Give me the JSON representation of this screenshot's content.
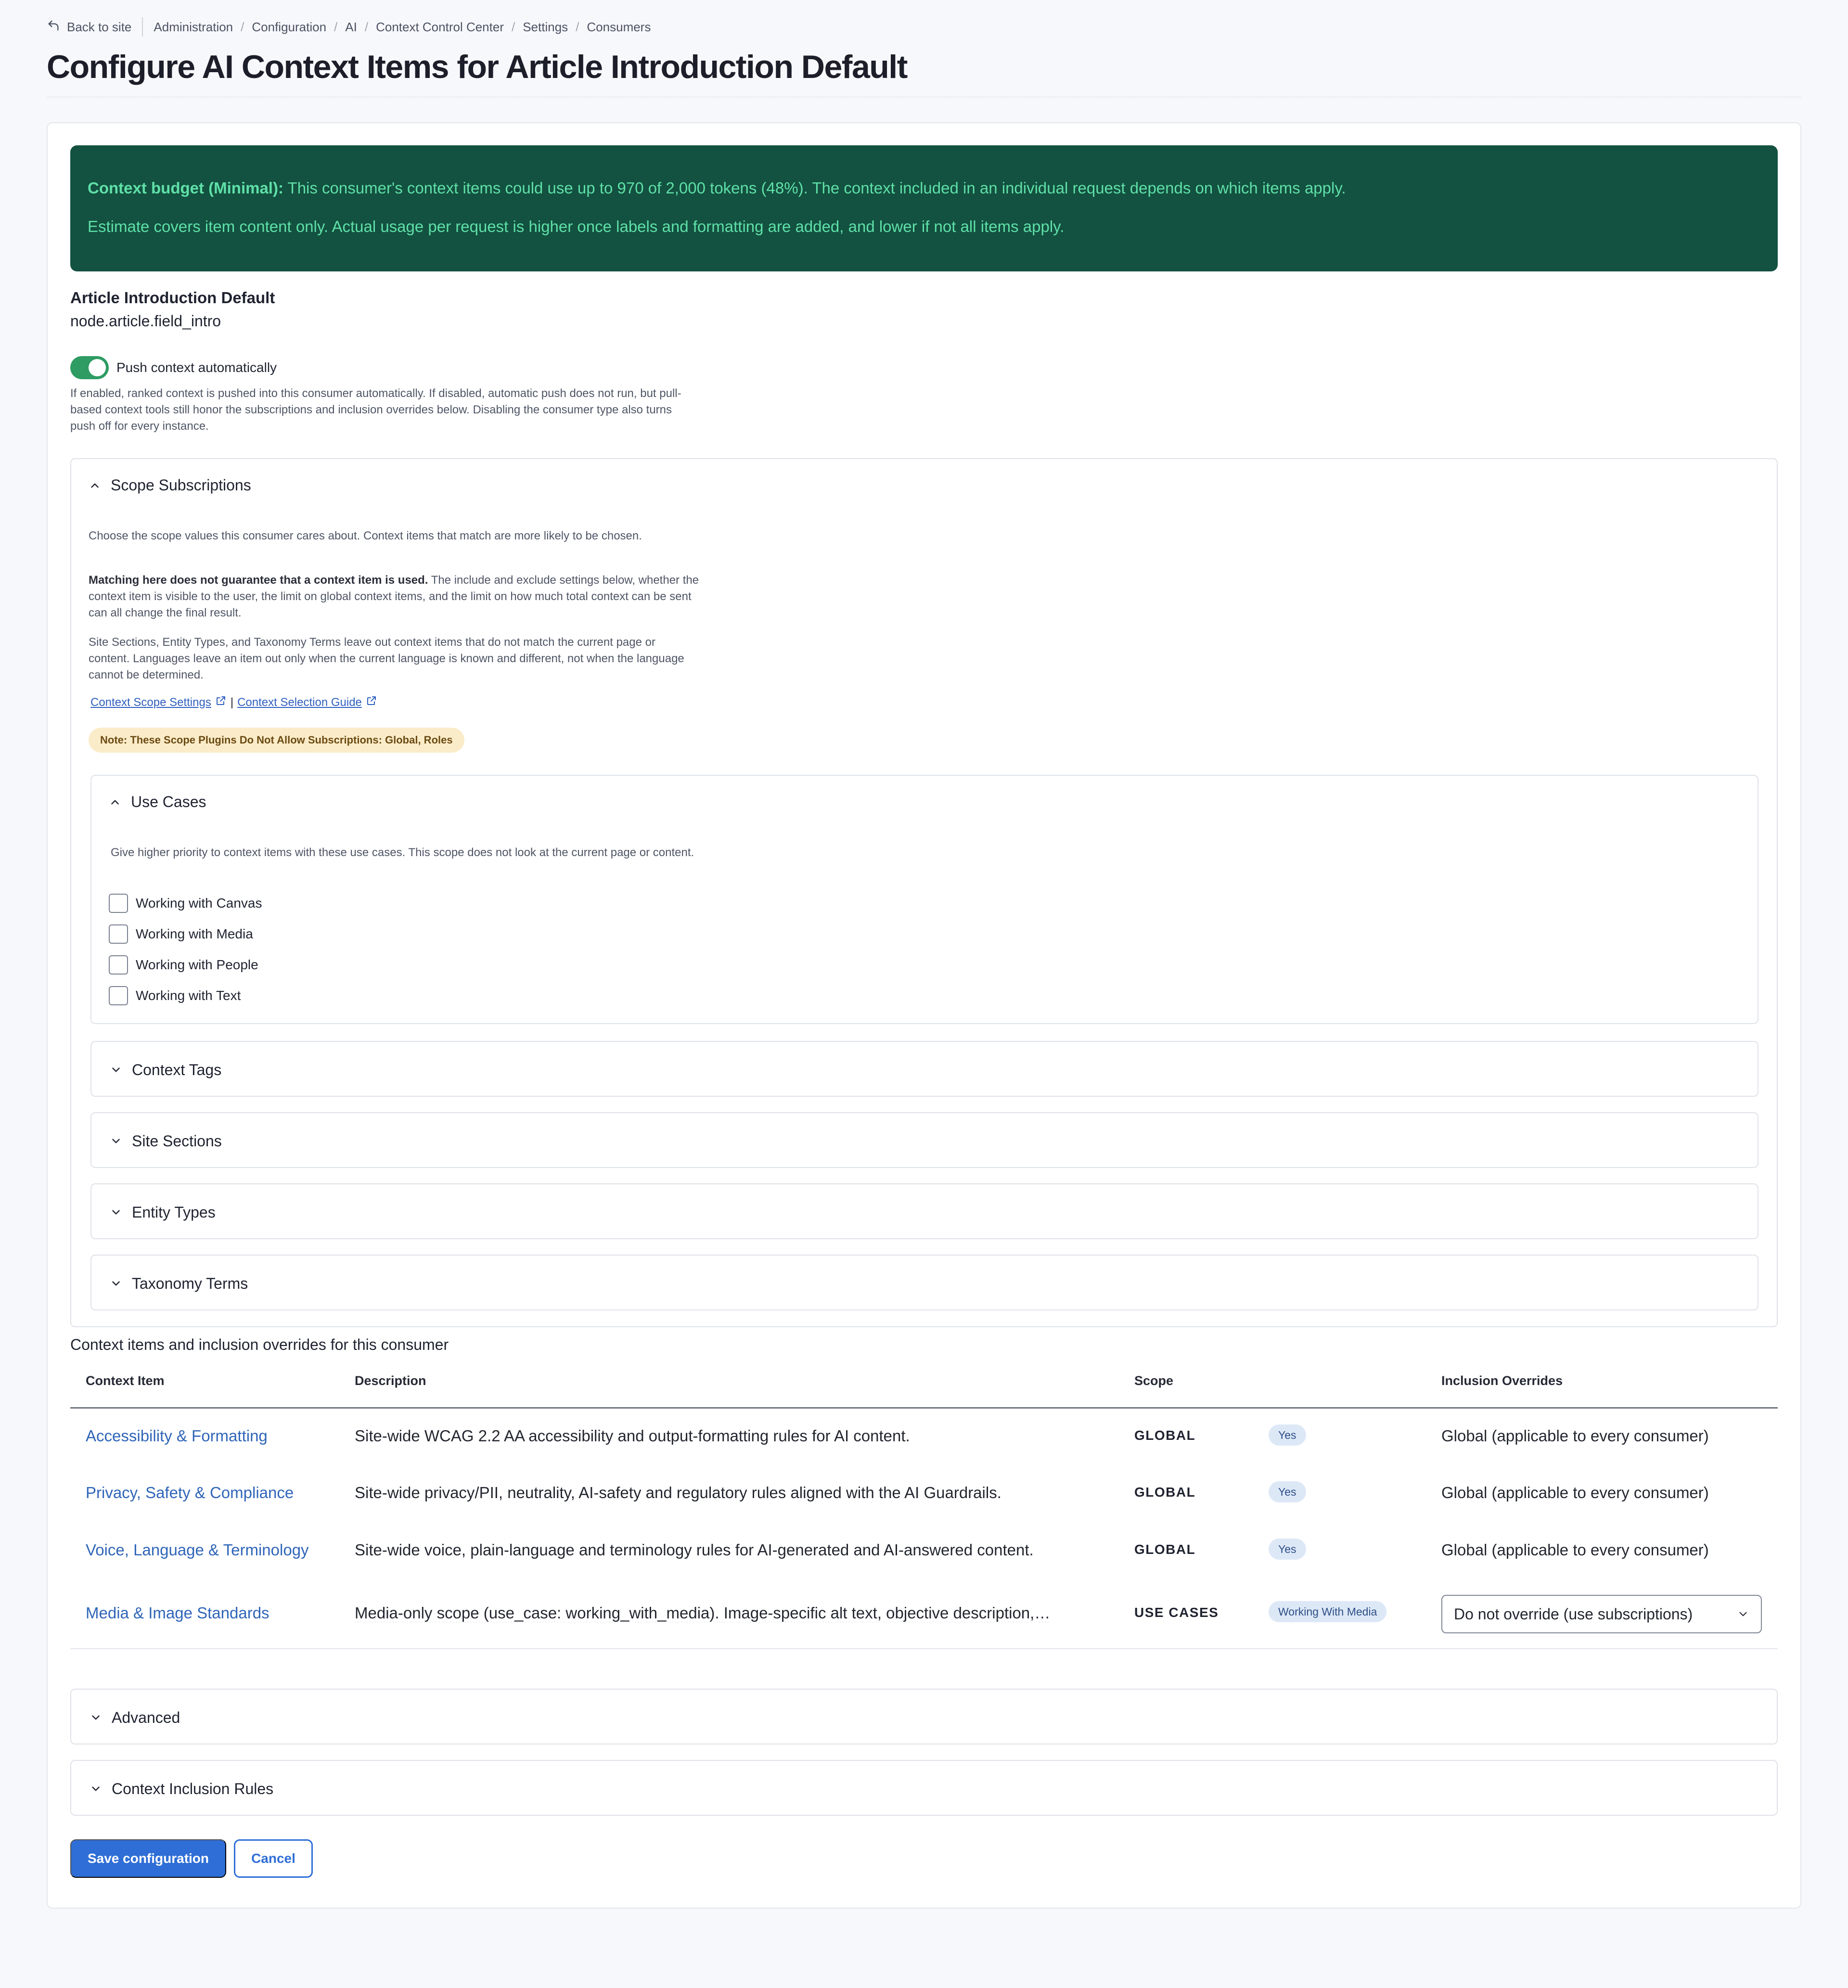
{
  "breadcrumb": {
    "back": "Back to site",
    "items": [
      "Administration",
      "Configuration",
      "AI",
      "Context Control Center",
      "Settings",
      "Consumers"
    ],
    "separator": "/"
  },
  "page_title": "Configure AI Context Items for Article Introduction Default",
  "budget": {
    "label": "Context budget (Minimal):",
    "text": " This consumer's context items could use up to 970 of 2,000 tokens (48%). The context included in an individual request depends on which items apply.",
    "note": "Estimate covers item content only. Actual usage per request is higher once labels and formatting are added, and lower if not all items apply."
  },
  "consumer": {
    "name": "Article Introduction Default",
    "machine_name": "node.article.field_intro"
  },
  "push": {
    "label": "Push context automatically",
    "enabled": true,
    "description": "If enabled, ranked context is pushed into this consumer automatically. If disabled, automatic push does not run, but pull-based context tools still honor the subscriptions and inclusion overrides below. Disabling the consumer type also turns push off for every instance."
  },
  "scope": {
    "title": "Scope Subscriptions",
    "intro": "Choose the scope values this consumer cares about. Context items that match are more likely to be chosen.",
    "warning_bold": "Matching here does not guarantee that a context item is used.",
    "warning_rest": " The include and exclude settings below, whether the context item is visible to the user, the limit on global context items, and the limit on how much total context can be sent can all change the final result.",
    "filter_note": "Site Sections, Entity Types, and Taxonomy Terms leave out context items that do not match the current page or content. Languages leave an item out only when the current language is known and different, not when the language cannot be determined.",
    "link1": "Context Scope Settings",
    "link2": "Context Selection Guide",
    "link_sep": "|",
    "badge": "Note: These Scope Plugins Do Not Allow Subscriptions: Global, Roles",
    "use_cases": {
      "title": "Use Cases",
      "description": "Give higher priority to context items with these use cases. This scope does not look at the current page or content.",
      "options": [
        "Working with Canvas",
        "Working with Media",
        "Working with People",
        "Working with Text"
      ]
    },
    "collapsed": [
      "Context Tags",
      "Site Sections",
      "Entity Types",
      "Taxonomy Terms"
    ]
  },
  "table": {
    "caption": "Context items and inclusion overrides for this consumer",
    "headers": [
      "Context Item",
      "Description",
      "Scope",
      "Inclusion Overrides"
    ],
    "rows": [
      {
        "item": "Accessibility & Formatting",
        "description": "Site-wide WCAG 2.2 AA accessibility and output-formatting rules for AI content.",
        "scope": "GLOBAL",
        "badge": "Yes",
        "override": "Global (applicable to every consumer)"
      },
      {
        "item": "Privacy, Safety & Compliance",
        "description": "Site-wide privacy/PII, neutrality, AI-safety and regulatory rules aligned with the AI Guardrails.",
        "scope": "GLOBAL",
        "badge": "Yes",
        "override": "Global (applicable to every consumer)"
      },
      {
        "item": "Voice, Language & Terminology",
        "description": "Site-wide voice, plain-language and terminology rules for AI-generated and AI-answered content.",
        "scope": "GLOBAL",
        "badge": "Yes",
        "override": "Global (applicable to every consumer)"
      },
      {
        "item": "Media & Image Standards",
        "description": "Media-only scope (use_case: working_with_media). Image-specific alt text, objective description,…",
        "scope": "USE CASES",
        "badge": "Working With Media",
        "override": "Do not override (use subscriptions)"
      }
    ]
  },
  "advanced": "Advanced",
  "inclusion_rules": "Context Inclusion Rules",
  "actions": {
    "save": "Save configuration",
    "cancel": "Cancel"
  },
  "colors": {
    "accent": "#2f6ed6",
    "budget_bg": "#135140",
    "budget_text": "#5fe0a8",
    "toggle_on": "#2e9c63",
    "link": "#2f65b8"
  }
}
